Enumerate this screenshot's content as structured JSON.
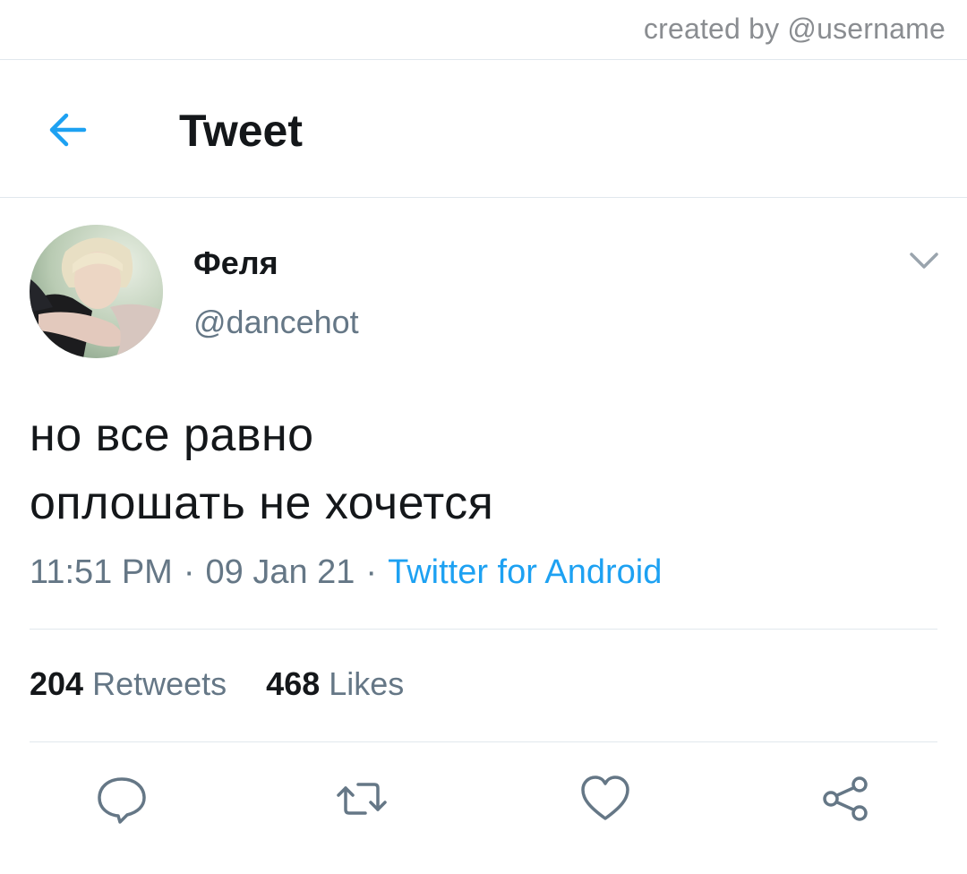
{
  "watermark": {
    "text": "created by @username"
  },
  "header": {
    "title": "Tweet",
    "back_icon": "arrow-left-icon"
  },
  "tweet": {
    "author": {
      "display_name": "Феля",
      "handle": "@dancehot",
      "avatar": "profile-photo"
    },
    "text_lines": [
      "но все равно",
      "оплошать не хочется"
    ],
    "time": "11:51 PM",
    "date": "09 Jan 21",
    "separator": "·",
    "source": "Twitter for Android",
    "stats": {
      "retweets": {
        "count": "204",
        "label": "Retweets"
      },
      "likes": {
        "count": "468",
        "label": "Likes"
      }
    }
  },
  "actions": [
    {
      "name": "reply",
      "icon": "speech-bubble-icon"
    },
    {
      "name": "retweet",
      "icon": "retweet-arrows-icon"
    },
    {
      "name": "like",
      "icon": "heart-icon"
    },
    {
      "name": "share",
      "icon": "share-nodes-icon"
    }
  ],
  "colors": {
    "accent": "#1da1f2",
    "text_primary": "#14171a",
    "text_secondary": "#657786",
    "divider": "#e1e8ed",
    "icon_gray": "#657786"
  }
}
